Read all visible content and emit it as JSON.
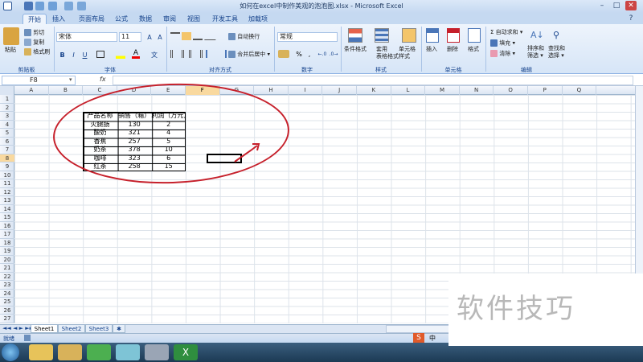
{
  "window": {
    "title": "如何在excel中制作美观的泡泡图.xlsx - Microsoft Excel",
    "min": "–",
    "max": "□",
    "close": "✕"
  },
  "tabs": [
    "开始",
    "插入",
    "页面布局",
    "公式",
    "数据",
    "审阅",
    "视图",
    "开发工具",
    "加载项"
  ],
  "ribbon": {
    "clipboard": {
      "paste": "粘贴",
      "cut": "剪切",
      "copy": "复制",
      "format_painter": "格式刷",
      "label": "剪贴板"
    },
    "font": {
      "name": "宋体",
      "size": "11",
      "bold": "B",
      "italic": "I",
      "underline": "U",
      "label": "字体"
    },
    "alignment": {
      "wrap": "自动换行",
      "merge": "合并后居中 ▾",
      "label": "对齐方式"
    },
    "number": {
      "format": "常规",
      "percent": "%",
      "comma": ",",
      "label": "数字"
    },
    "styles": {
      "conditional": "条件格式",
      "table1": "套用",
      "table2": "表格格式",
      "cell1": "单元格",
      "cell2": "样式",
      "label": "样式"
    },
    "cells": {
      "insert": "插入",
      "delete": "删除",
      "format": "格式",
      "label": "单元格"
    },
    "editing": {
      "autosum": "Σ 自动求和 ▾",
      "fill": "填充 ▾",
      "clear": "清除 ▾",
      "sort1": "排序和",
      "sort2": "筛选 ▾",
      "find1": "查找和",
      "find2": "选择 ▾",
      "label": "编辑"
    }
  },
  "formula_bar": {
    "name_box": "F8",
    "fx": "fx",
    "value": ""
  },
  "columns": [
    "A",
    "B",
    "C",
    "D",
    "E",
    "F",
    "G",
    "H",
    "I",
    "J",
    "K",
    "L",
    "M",
    "N",
    "O",
    "P",
    "Q"
  ],
  "rows": [
    "1",
    "2",
    "3",
    "4",
    "5",
    "6",
    "7",
    "8",
    "9",
    "10",
    "11",
    "12",
    "13",
    "14",
    "15",
    "16",
    "17",
    "18",
    "19",
    "20",
    "21",
    "22",
    "23",
    "24",
    "25",
    "26",
    "27"
  ],
  "selected_cell": "F8",
  "table": {
    "headers": [
      "产品名称",
      "销售（箱）",
      "利润（万元）"
    ],
    "rows": [
      [
        "火腿肠",
        "130",
        "2"
      ],
      [
        "酸奶",
        "321",
        "4"
      ],
      [
        "香蕉",
        "257",
        "5"
      ],
      [
        "奶茶",
        "378",
        "10"
      ],
      [
        "咖啡",
        "323",
        "6"
      ],
      [
        "红茶",
        "258",
        "15"
      ]
    ]
  },
  "sheets": [
    "Sheet1",
    "Sheet2",
    "Sheet3"
  ],
  "active_sheet": "Sheet1",
  "status": {
    "ready": "就绪"
  },
  "watermark": "软件技巧",
  "ime": "中"
}
